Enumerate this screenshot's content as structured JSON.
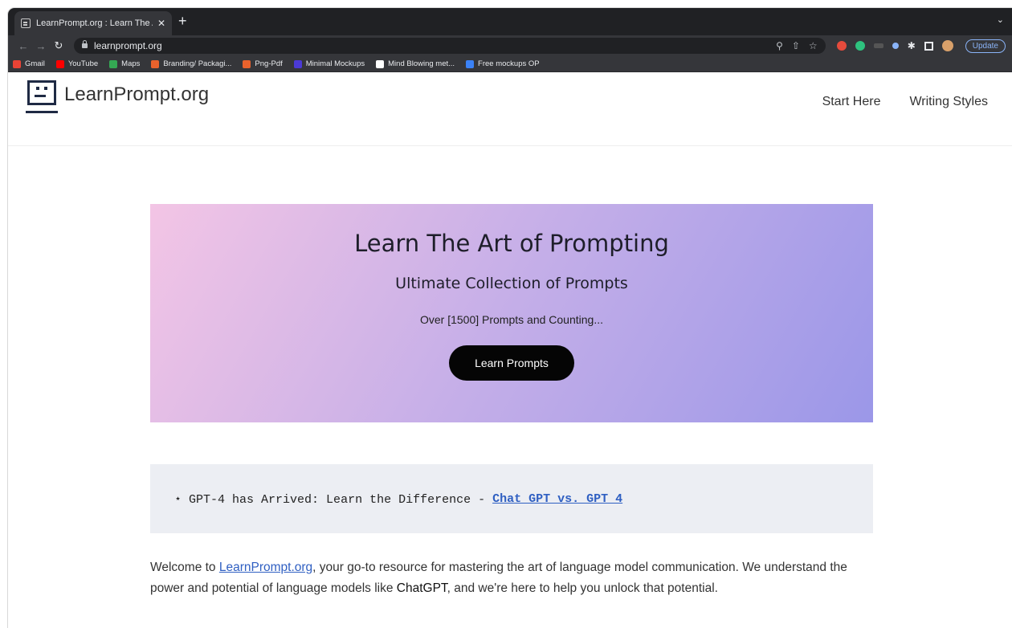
{
  "browser": {
    "tab_title": "LearnPrompt.org : Learn The A",
    "new_tab": "+",
    "url": "learnprompt.org",
    "update_label": "Update",
    "bookmarks": [
      {
        "label": "Gmail",
        "icon": "gmail-icon",
        "color": "#ea4335"
      },
      {
        "label": "YouTube",
        "icon": "youtube-icon",
        "color": "#ff0000"
      },
      {
        "label": "Maps",
        "icon": "maps-icon",
        "color": "#34a853"
      },
      {
        "label": "Branding/ Packagi...",
        "icon": "branding-icon",
        "color": "#e8622c"
      },
      {
        "label": "Png-Pdf",
        "icon": "png-pdf-icon",
        "color": "#e8622c"
      },
      {
        "label": "Minimal Mockups",
        "icon": "minimal-mockups-icon",
        "color": "#4b3ad6"
      },
      {
        "label": "Mind Blowing met...",
        "icon": "mind-blowing-icon",
        "color": "#ffffff"
      },
      {
        "label": "Free mockups OP",
        "icon": "free-mockups-icon",
        "color": "#3b82f6"
      }
    ]
  },
  "site": {
    "logo_text": "LearnPrompt.org",
    "nav": [
      "Start Here",
      "Writing Styles"
    ]
  },
  "hero": {
    "title": "Learn The Art of Prompting",
    "subtitle": "Ultimate Collection of Prompts",
    "tagline": "Over [1500] Prompts and Counting...",
    "cta": "Learn Prompts",
    "gradient": [
      "#f3c5e5",
      "#9b97e8"
    ]
  },
  "notice": {
    "prefix": "⋆ GPT-4 has Arrived: Learn the Difference -",
    "link": "Chat GPT vs. GPT 4"
  },
  "intro": {
    "before": "Welcome to ",
    "link": "LearnPrompt.org",
    "middle": ", your go-to resource for mastering the art of language model communication. We understand the power and potential of language models like ",
    "bold": "ChatGPT",
    "after": ", and we're here to help you unlock that potential."
  }
}
